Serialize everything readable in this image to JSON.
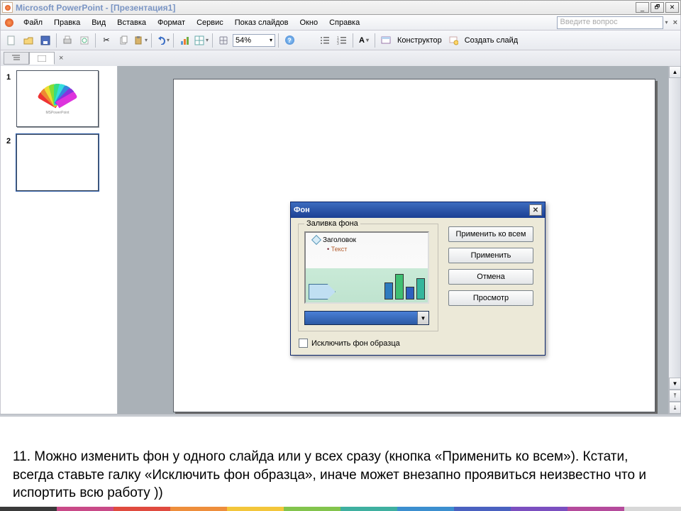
{
  "titlebar": {
    "title": "Microsoft PowerPoint - [Презентация1]"
  },
  "menu": {
    "items": [
      "Файл",
      "Правка",
      "Вид",
      "Вставка",
      "Формат",
      "Сервис",
      "Показ слайдов",
      "Окно",
      "Справка"
    ],
    "question_box": "Введите вопрос"
  },
  "toolbar": {
    "zoom": "54%",
    "designer": "Конструктор",
    "new_slide": "Создать слайд"
  },
  "thumbs": {
    "slide1": "1",
    "slide2": "2"
  },
  "dialog": {
    "title": "Фон",
    "legend": "Заливка фона",
    "preview_title": "Заголовок",
    "preview_text": "Текст",
    "exclude": "Исключить фон образца",
    "btn_all": "Применить ко всем",
    "btn_apply": "Применить",
    "btn_cancel": "Отмена",
    "btn_preview": "Просмотр"
  },
  "caption": "11.   Можно изменить фон у одного слайда или у всех сразу (кнопка «Применить ко всем»). Кстати, всегда ставьте галку «Исключить фон образца», иначе может внезапно проявиться неизвестно что и испортить всю работу ))"
}
